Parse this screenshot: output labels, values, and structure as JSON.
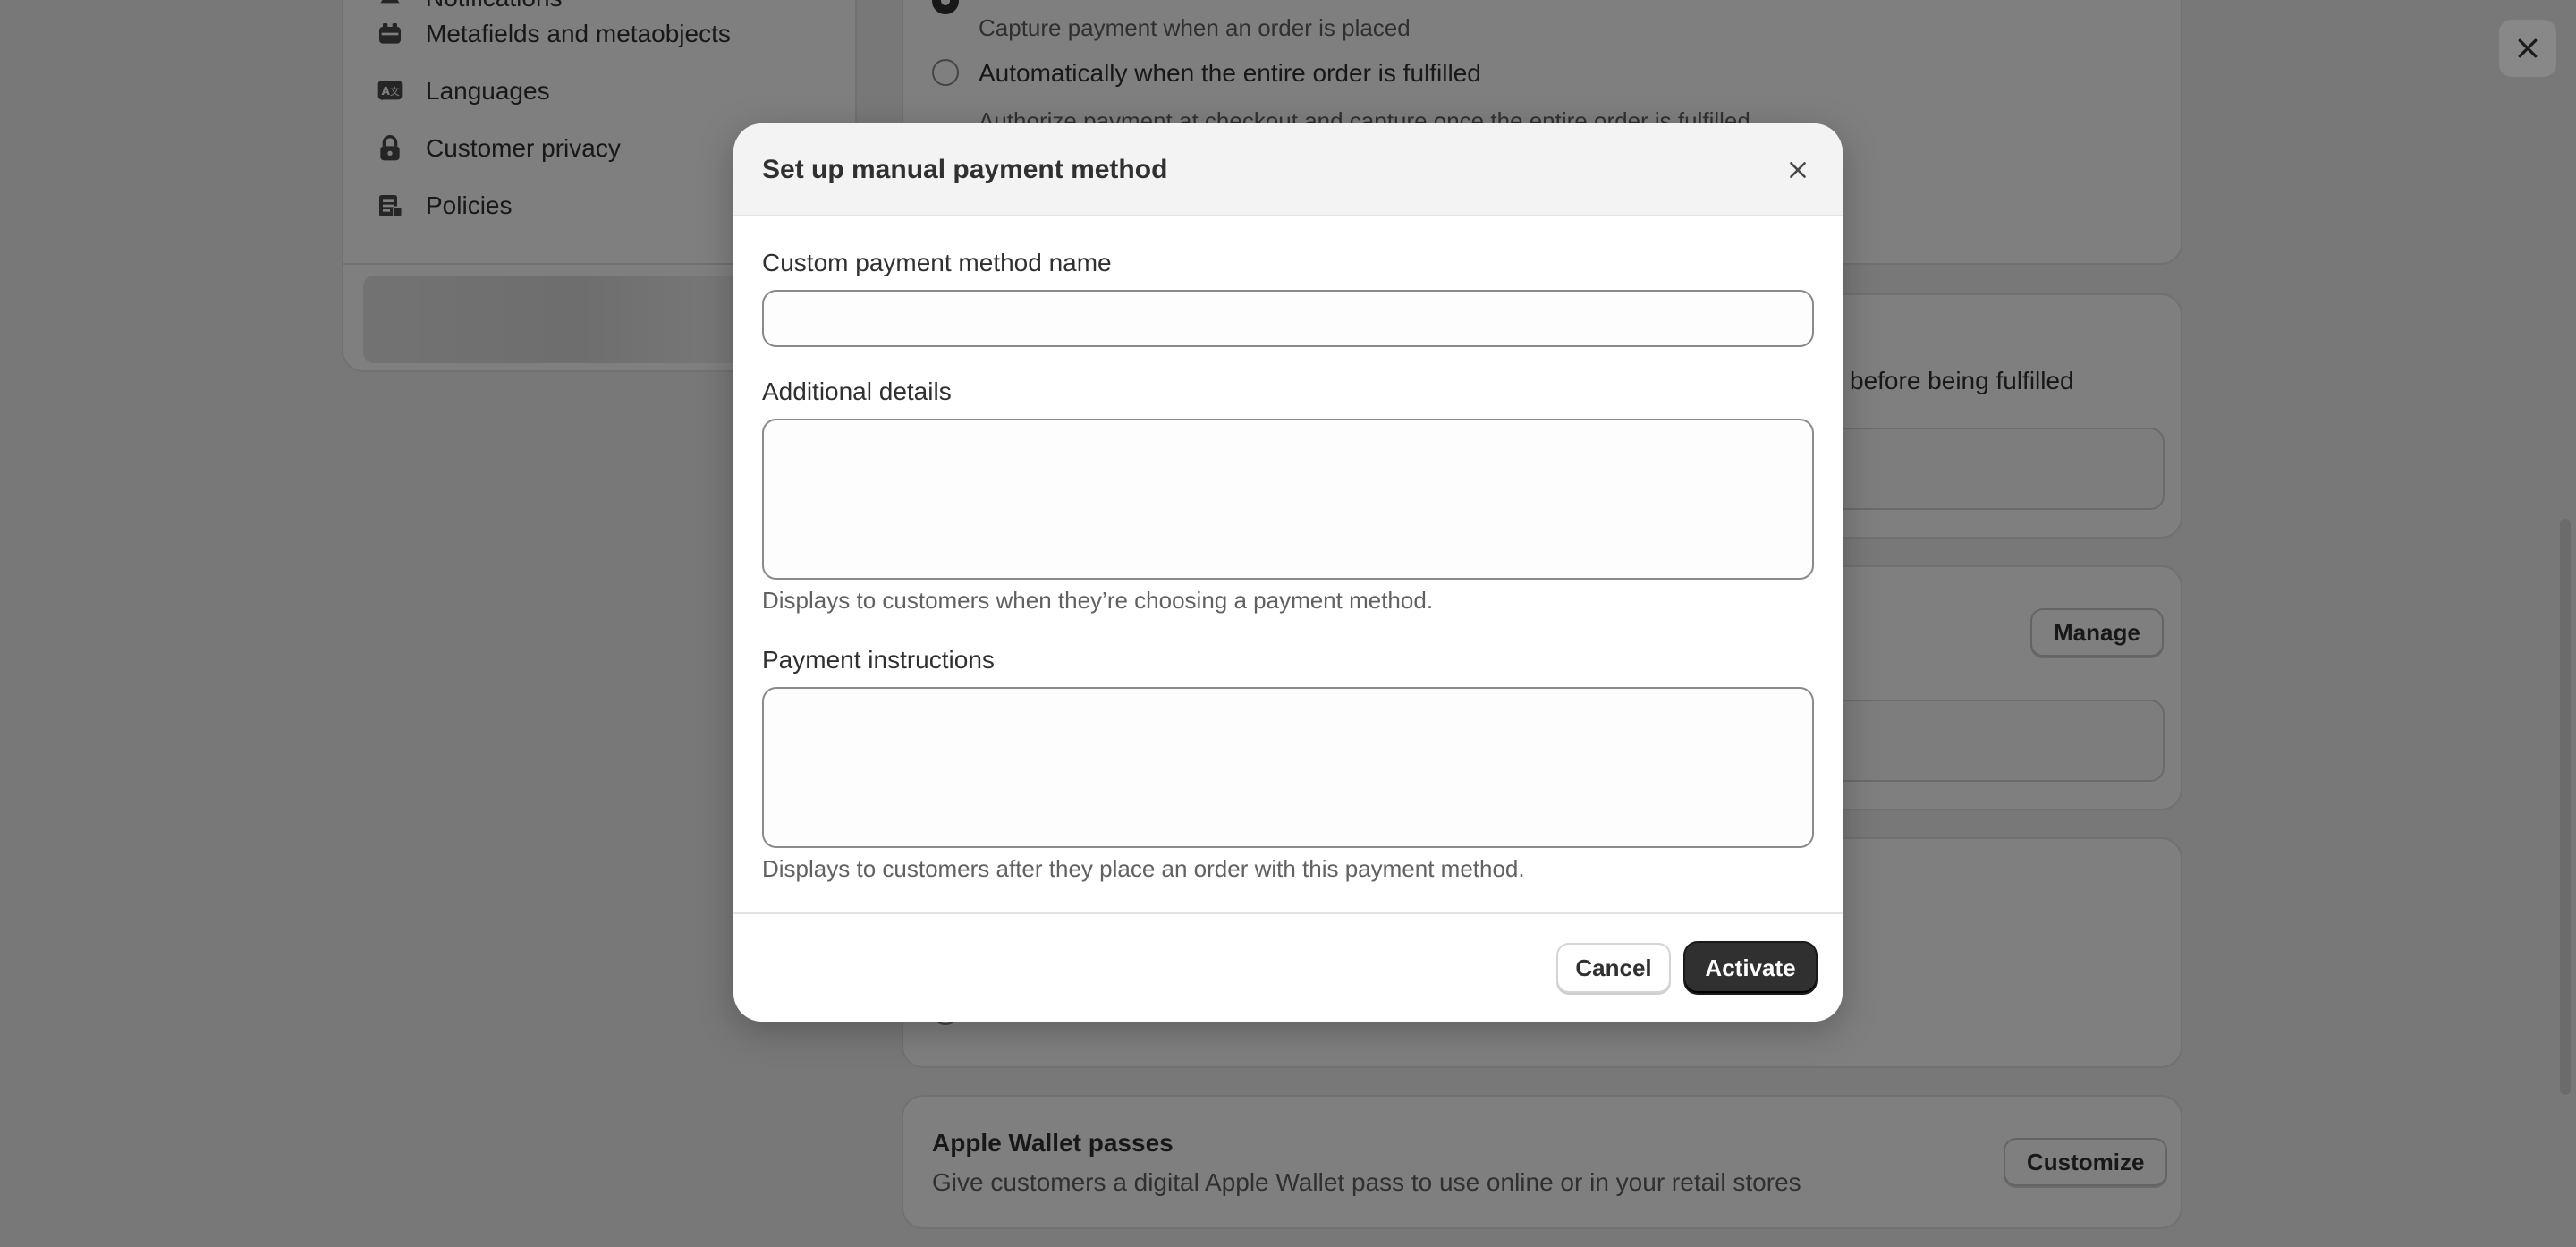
{
  "sidebar": {
    "items": [
      {
        "label": "Notifications",
        "icon": "bell-icon"
      },
      {
        "label": "Metafields and metaobjects",
        "icon": "metafields-icon"
      },
      {
        "label": "Languages",
        "icon": "languages-icon"
      },
      {
        "label": "Customer privacy",
        "icon": "lock-icon"
      },
      {
        "label": "Policies",
        "icon": "policies-icon"
      }
    ]
  },
  "payment_capture": {
    "opt1_help": "Capture payment when an order is placed",
    "opt2_label": "Automatically when the entire order is fulfilled",
    "opt2_help": "Authorize payment at checkout and capture once the entire order is fulfilled"
  },
  "card2": {
    "partial_text": "before being fulfilled"
  },
  "card3": {
    "manage_label": "Manage"
  },
  "apple_wallet": {
    "title": "Apple Wallet passes",
    "description": "Give customers a digital Apple Wallet pass to use online or in your retail stores",
    "button_label": "Customize"
  },
  "modal": {
    "title": "Set up manual payment method",
    "name_label": "Custom payment method name",
    "name_value": "",
    "details_label": "Additional details",
    "details_value": "",
    "details_help": "Displays to customers when they’re choosing a payment method.",
    "instructions_label": "Payment instructions",
    "instructions_value": "",
    "instructions_help": "Displays to customers after they place an order with this payment method.",
    "cancel_label": "Cancel",
    "activate_label": "Activate"
  },
  "colors": {
    "primary_button": "#303030",
    "overlay": "rgba(0,0,0,0.5)",
    "background": "#f1f1f1"
  }
}
